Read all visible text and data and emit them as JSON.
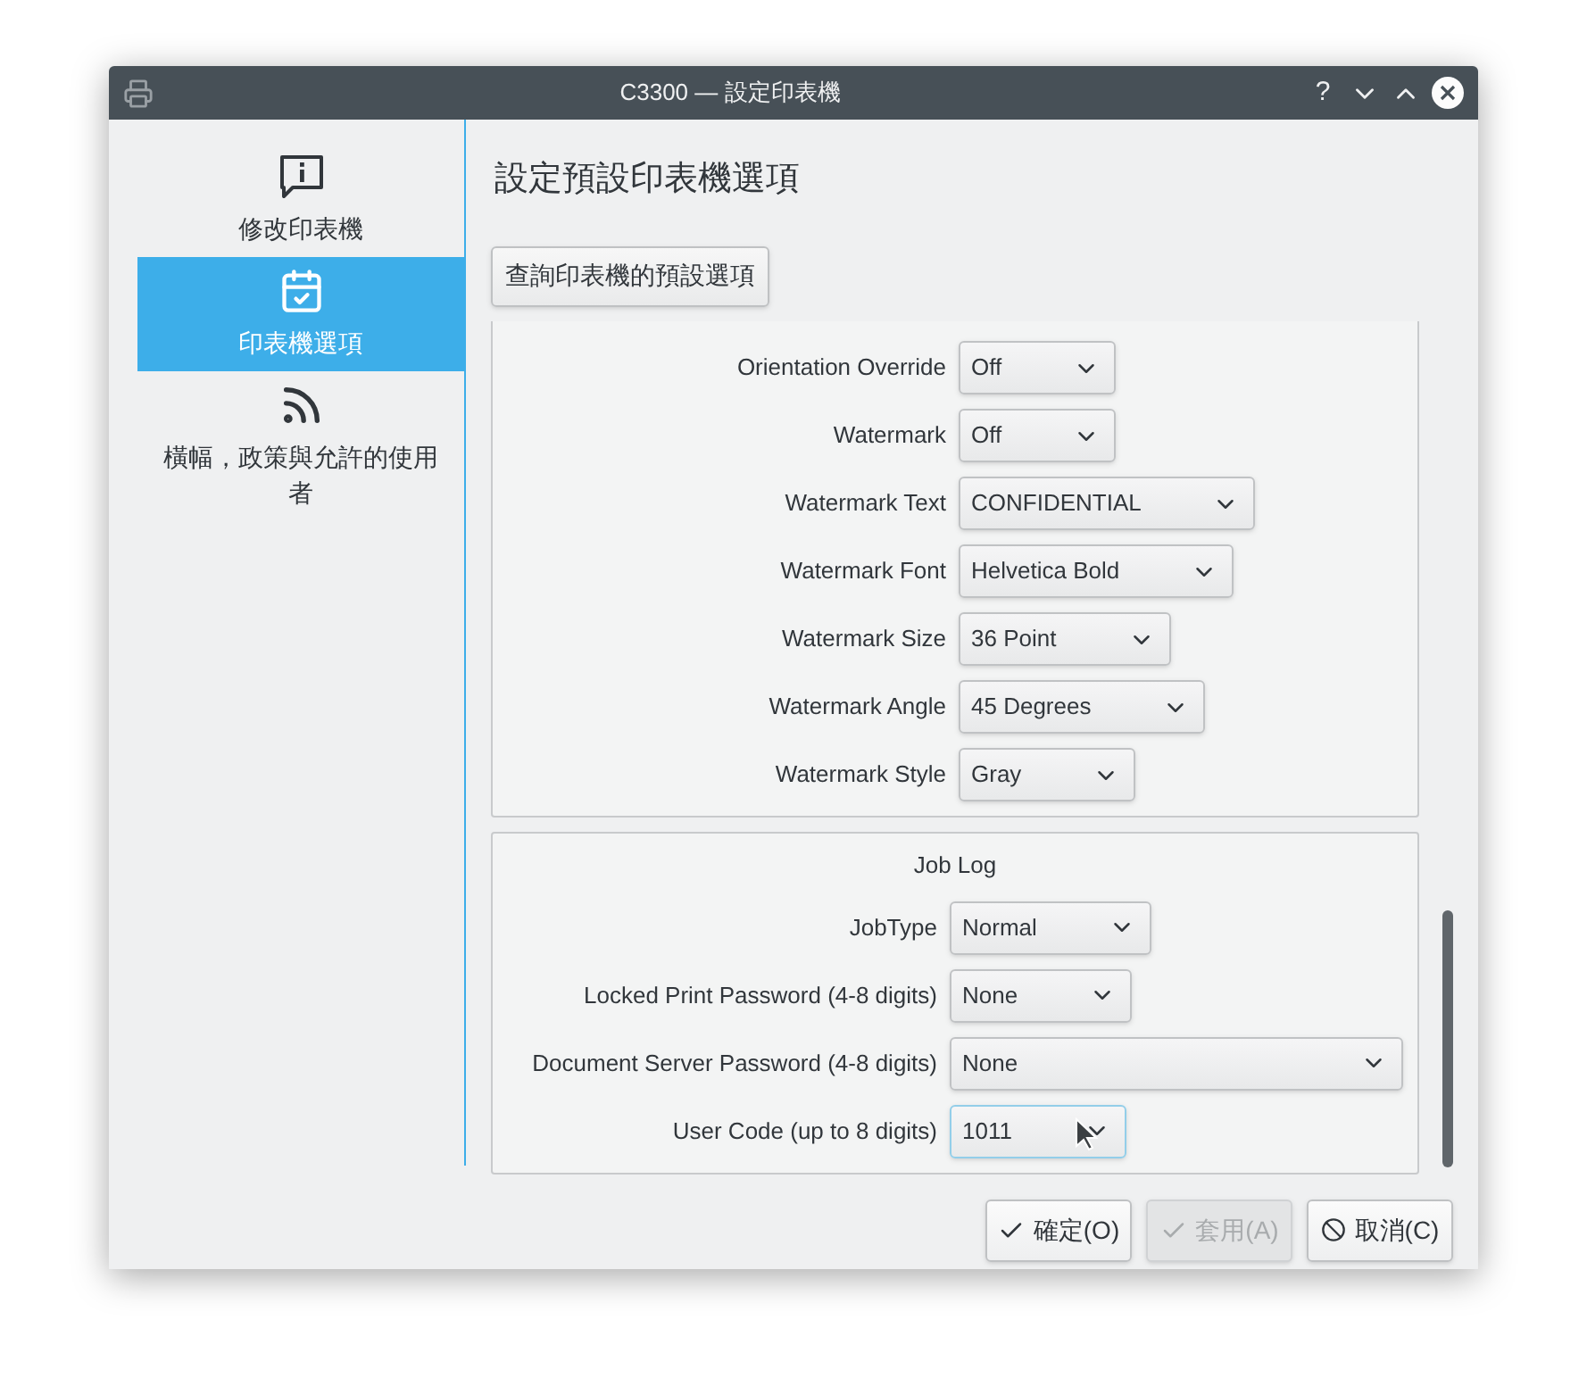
{
  "window": {
    "title": "C3300 — 設定印表機",
    "help": "?"
  },
  "sidebar": {
    "items": [
      {
        "kind": "info",
        "label": "修改印表機",
        "selected": false
      },
      {
        "kind": "calendar",
        "label": "印表機選項",
        "selected": true
      },
      {
        "kind": "feed",
        "label": "橫幅，政策與允許的使用者",
        "selected": false
      }
    ]
  },
  "heading": "設定預設印表機選項",
  "query_button": "查詢印表機的預設選項",
  "groups": [
    {
      "rows": [
        {
          "label": "Orientation Override",
          "value": "Off",
          "focused": false
        },
        {
          "label": "Watermark",
          "value": "Off",
          "focused": false
        },
        {
          "label": "Watermark Text",
          "value": "CONFIDENTIAL",
          "focused": false
        },
        {
          "label": "Watermark Font",
          "value": "Helvetica Bold",
          "focused": false
        },
        {
          "label": "Watermark Size",
          "value": "36 Point",
          "focused": false
        },
        {
          "label": "Watermark Angle",
          "value": "45 Degrees",
          "focused": false
        },
        {
          "label": "Watermark Style",
          "value": "Gray",
          "focused": false
        }
      ]
    },
    {
      "title": "Job Log",
      "rows": [
        {
          "label": "JobType",
          "value": "Normal",
          "focused": false
        },
        {
          "label": "Locked Print Password (4-8 digits)",
          "value": "None",
          "focused": false
        },
        {
          "label": "Document Server Password (4-8 digits)",
          "value": "None",
          "focused": false,
          "wide": true
        },
        {
          "label": "User Code (up to 8 digits)",
          "value": "1011",
          "focused": true
        }
      ]
    }
  ],
  "buttons": [
    {
      "kind": "check",
      "label": "確定(O)",
      "disabled": false
    },
    {
      "kind": "check",
      "label": "套用(A)",
      "disabled": true
    },
    {
      "kind": "cancel",
      "label": "取消(C)",
      "disabled": false
    }
  ]
}
